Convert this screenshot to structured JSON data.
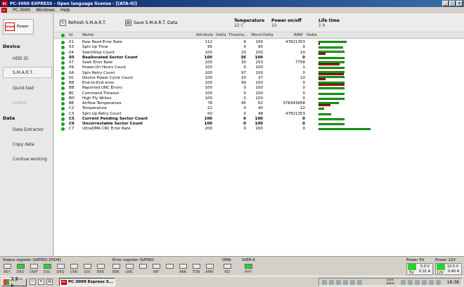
{
  "titlebar": {
    "title": "PC-3000 EXPRESS - Open language license - [(ATA-0)]",
    "min": "_",
    "max": "□",
    "close": "×",
    "app_icon": "PC"
  },
  "menu": {
    "items": [
      "PC-3000",
      "Windows",
      "Help"
    ]
  },
  "leftnav": {
    "power_label": "Power",
    "logo_text": "SARAB",
    "device_header": "Device",
    "device_items": [
      {
        "label": "HDD ID",
        "active": false,
        "disabled": false
      },
      {
        "label": "S.M.A.R.T.",
        "active": true,
        "disabled": false
      },
      {
        "label": "Quick test",
        "active": false,
        "disabled": false
      },
      {
        "label": "Unlock",
        "active": false,
        "disabled": true
      }
    ],
    "data_header": "Data",
    "data_items": [
      {
        "label": "Data Extractor"
      },
      {
        "label": "Copy data"
      },
      {
        "label": "Contiue working"
      }
    ]
  },
  "toolbar": {
    "refresh_label": "Refresh S.M.A.R.T.",
    "save_label": "Save S.M.A.R.T. Data",
    "temperature_label": "Temperature",
    "temperature_value": "22 C",
    "power_label": "Power on/off",
    "power_value": "10",
    "lifetime_label": "Life time",
    "lifetime_value": "1 h"
  },
  "table": {
    "headers": [
      "Id",
      "Name",
      "Attribute",
      "Delta",
      "Thresho...",
      "Worst",
      "Delta",
      "RAW",
      "Delta"
    ],
    "rows": [
      {
        "id": "01",
        "name": "Raw Read Error Rate",
        "attr": "112",
        "thr": "6",
        "worst": "100",
        "raw": "47821353",
        "bold": false,
        "green": 0.4,
        "red": 0.01
      },
      {
        "id": "03",
        "name": "Spin Up Time",
        "attr": "95",
        "thr": "0",
        "worst": "95",
        "raw": "0",
        "bold": false,
        "green": 0.35,
        "red": 0
      },
      {
        "id": "04",
        "name": "Start/Stop Count",
        "attr": "100",
        "thr": "20",
        "worst": "100",
        "raw": "10",
        "bold": false,
        "green": 0.37,
        "red": 0.1
      },
      {
        "id": "05",
        "name": "Reallocated Sector Count",
        "attr": "100",
        "thr": "36",
        "worst": "100",
        "raw": "0",
        "bold": true,
        "green": 0.37,
        "red": 0
      },
      {
        "id": "07",
        "name": "Seek Error Rate",
        "attr": "100",
        "thr": "30",
        "worst": "253",
        "raw": "7758",
        "bold": false,
        "green": 0.37,
        "red": 0.3
      },
      {
        "id": "09",
        "name": "Power-On Hours Count",
        "attr": "100",
        "thr": "0",
        "worst": "100",
        "raw": "1",
        "bold": false,
        "green": 0.37,
        "red": 0
      },
      {
        "id": "0A",
        "name": "Spin Retry Count",
        "attr": "100",
        "thr": "97",
        "worst": "100",
        "raw": "0",
        "bold": false,
        "green": 0.37,
        "red": 0.36
      },
      {
        "id": "0C",
        "name": "Device Power Cycle Count",
        "attr": "100",
        "thr": "20",
        "worst": "37",
        "raw": "10",
        "bold": false,
        "green": 0.37,
        "red": 0.1
      },
      {
        "id": "B8",
        "name": "End-to-End error",
        "attr": "100",
        "thr": "99",
        "worst": "100",
        "raw": "0",
        "bold": false,
        "green": 0.37,
        "red": 0.37
      },
      {
        "id": "BB",
        "name": "Reported UNC Errors",
        "attr": "100",
        "thr": "0",
        "worst": "100",
        "raw": "0",
        "bold": false,
        "green": 0.37,
        "red": 0
      },
      {
        "id": "BC",
        "name": "Command Timeout",
        "attr": "100",
        "thr": "0",
        "worst": "100",
        "raw": "0",
        "bold": false,
        "green": 0.37,
        "red": 0
      },
      {
        "id": "BD",
        "name": "High Fly Writes",
        "attr": "100",
        "thr": "0",
        "worst": "100",
        "raw": "0",
        "bold": false,
        "green": 0.37,
        "red": 0
      },
      {
        "id": "BE",
        "name": "Airflow Temperature",
        "attr": "78",
        "thr": "45",
        "worst": "62",
        "raw": "378343958",
        "bold": false,
        "green": 0.29,
        "red": 0.17
      },
      {
        "id": "C2",
        "name": "Temperature",
        "attr": "22",
        "thr": "0",
        "worst": "40",
        "raw": "22",
        "bold": false,
        "green": 0.08,
        "red": 0
      },
      {
        "id": "C3",
        "name": "Spin Up Retry Count",
        "attr": "50",
        "thr": "0",
        "worst": "48",
        "raw": "47821353",
        "bold": false,
        "green": 0.18,
        "red": 0
      },
      {
        "id": "C5",
        "name": "Current Pending Sector Count",
        "attr": "100",
        "thr": "0",
        "worst": "100",
        "raw": "0",
        "bold": true,
        "green": 0.37,
        "red": 0
      },
      {
        "id": "C6",
        "name": "Uncorrectable Sector Count",
        "attr": "100",
        "thr": "0",
        "worst": "100",
        "raw": "0",
        "bold": true,
        "green": 0.37,
        "red": 0
      },
      {
        "id": "C7",
        "name": "UltraDMA CRC Error Rate",
        "attr": "200",
        "thr": "0",
        "worst": "200",
        "raw": "0",
        "bold": false,
        "green": 0.74,
        "red": 0
      }
    ]
  },
  "status": {
    "status_title": "Status register (SATA0)-[PIO4]",
    "status_leds": [
      {
        "label": "BSY",
        "on": false
      },
      {
        "label": "DRD",
        "on": true
      },
      {
        "label": "DWF",
        "on": false
      },
      {
        "label": "DSC",
        "on": true
      },
      {
        "label": "DRQ",
        "on": false
      },
      {
        "label": "CRR",
        "on": false
      },
      {
        "label": "IDX",
        "on": false
      },
      {
        "label": "ERR",
        "on": false
      }
    ],
    "error_title": "Error register (SATA0)",
    "error_leds": [
      {
        "label": "BBK",
        "on": false
      },
      {
        "label": "UNC",
        "on": false
      },
      {
        "label": "",
        "on": false
      },
      {
        "label": "INF",
        "on": false
      },
      {
        "label": "",
        "on": false
      },
      {
        "label": "ABR",
        "on": false
      },
      {
        "label": "TON",
        "on": false
      },
      {
        "label": "AMN",
        "on": false
      }
    ],
    "dma_title": "DMA",
    "dma_led": {
      "label": "RQ",
      "on": false
    },
    "sata_title": "SATA-II",
    "sata_led": {
      "label": "PHY",
      "on": true
    },
    "power5_title": "Power 5V",
    "power5_tag": "5V",
    "power5_volt": "5.0 V",
    "power5_amp": "0.31 A",
    "power12_title": "Power 12V",
    "power12_tag": "12V",
    "power12_volt": "12.0 V",
    "power12_amp": "0.40 A"
  },
  "taskbar": {
    "start_label": "スタート",
    "task_label": "PC-3000 Express S...",
    "tray_lang_1": "core",
    "tray_lang_2": "kana",
    "clock": "18:38"
  },
  "colors": {
    "green": "#1ec81e",
    "red": "#d21f1f",
    "led_on": "#2cd22c"
  }
}
